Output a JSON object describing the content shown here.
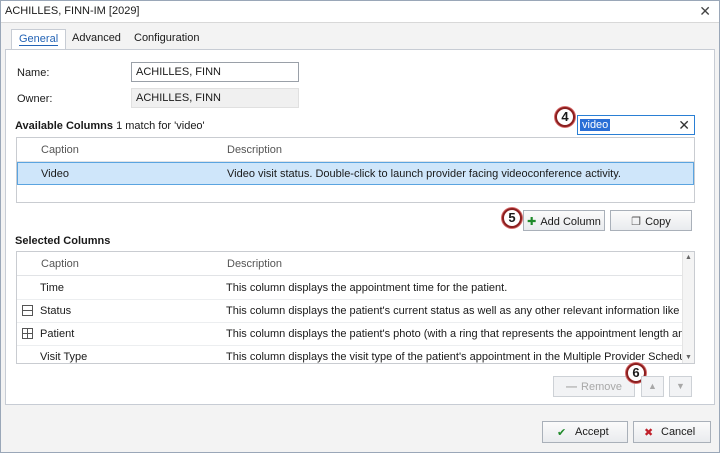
{
  "window": {
    "title": "ACHILLES, FINN-IM [2029]",
    "close_glyph": "✕"
  },
  "tabs": [
    {
      "label": "General",
      "active": true
    },
    {
      "label": "Advanced",
      "active": false
    },
    {
      "label": "Configuration",
      "active": false
    }
  ],
  "form": {
    "name_label": "Name:",
    "name_value": "ACHILLES, FINN",
    "owner_label": "Owner:",
    "owner_value": "ACHILLES, FINN"
  },
  "available": {
    "title": "Available Columns",
    "match_text": "1 match for 'video'",
    "search_value": "video",
    "search_clear": "✕",
    "header": {
      "caption": "Caption",
      "description": "Description"
    },
    "rows": [
      {
        "caption": "Video",
        "description": "Video visit status. Double-click to launch provider facing videoconference activity."
      }
    ]
  },
  "actions": {
    "add_column": "Add Column",
    "copy": "Copy"
  },
  "selected": {
    "title": "Selected Columns",
    "header": {
      "caption": "Caption",
      "description": "Description"
    },
    "rows": [
      {
        "caption": "Time",
        "description": "This column displays the appointment time for the patient.",
        "icon": ""
      },
      {
        "caption": "Status",
        "description": "This column displays the patient's current status as well as any other relevant information like th…",
        "icon": "status-row-icon"
      },
      {
        "caption": "Patient",
        "description": "This column displays the patient's photo (with a ring that represents the appointment length and…",
        "icon": "patient-row-icon"
      },
      {
        "caption": "Visit Type",
        "description": "This column displays the visit type of the patient's appointment in the Multiple Provider Schedule.",
        "icon": ""
      }
    ]
  },
  "list_actions": {
    "remove": "Remove",
    "move_up": "▲",
    "move_down": "▼"
  },
  "callouts": {
    "four": "4",
    "five": "5",
    "six": "6"
  },
  "footer": {
    "accept": "Accept",
    "cancel": "Cancel"
  },
  "colors": {
    "accent": "#2363b5",
    "selected_row": "#cfe6fa",
    "accept_green": "#1f8a2a",
    "cancel_red": "#c0202a",
    "callout_ring": "#8b1f1f"
  }
}
